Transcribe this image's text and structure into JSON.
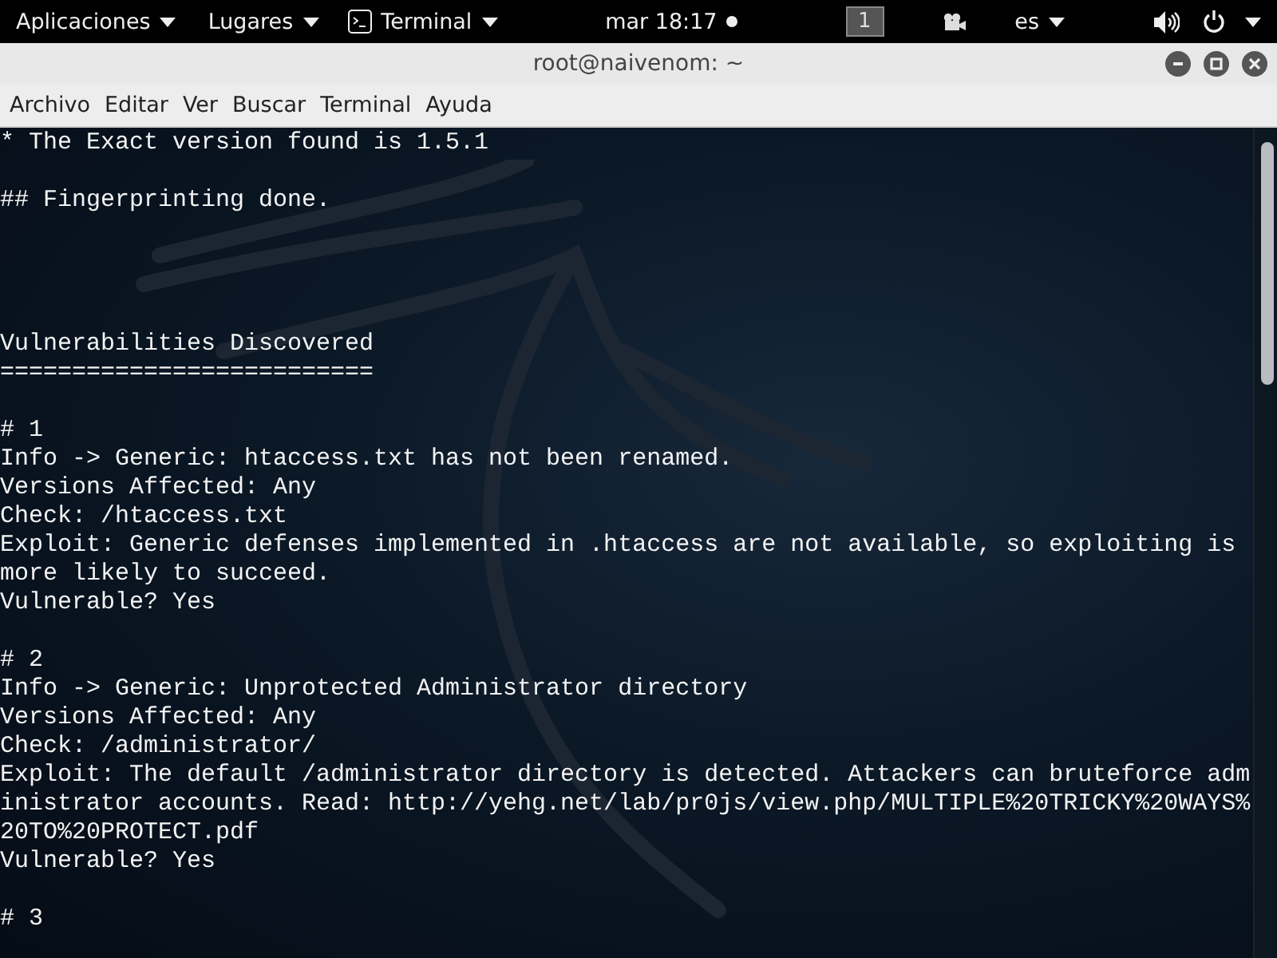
{
  "top_bar": {
    "menus": [
      {
        "kind": "plain",
        "label": "Aplicaciones"
      },
      {
        "kind": "plain",
        "label": "Lugares"
      },
      {
        "kind": "app",
        "label": "Terminal"
      }
    ],
    "clock": "mar 18:17",
    "workspace": "1",
    "language": "es"
  },
  "window": {
    "title": "root@naivenom: ~"
  },
  "menu_bar": [
    "Archivo",
    "Editar",
    "Ver",
    "Buscar",
    "Terminal",
    "Ayuda"
  ],
  "terminal": {
    "lines": [
      {
        "kind": "text",
        "text": "* The Exact version found is 1.5.1"
      },
      {
        "kind": "blank"
      },
      {
        "kind": "text",
        "text": "## Fingerprinting done."
      },
      {
        "kind": "blank"
      },
      {
        "kind": "blank"
      },
      {
        "kind": "blank"
      },
      {
        "kind": "blank"
      },
      {
        "kind": "text",
        "text": "Vulnerabilities Discovered"
      },
      {
        "kind": "text",
        "text": "=========================="
      },
      {
        "kind": "blank"
      },
      {
        "kind": "text",
        "text": "# 1"
      },
      {
        "kind": "text",
        "text": "Info -> Generic: htaccess.txt has not been renamed."
      },
      {
        "kind": "text",
        "text": "Versions Affected: Any"
      },
      {
        "kind": "text",
        "text": "Check: /htaccess.txt"
      },
      {
        "kind": "text",
        "text": "Exploit: Generic defenses implemented in .htaccess are not available, so exploiting is more likely to succeed."
      },
      {
        "kind": "text",
        "text": "Vulnerable? Yes"
      },
      {
        "kind": "blank"
      },
      {
        "kind": "text",
        "text": "# 2"
      },
      {
        "kind": "text",
        "text": "Info -> Generic: Unprotected Administrator directory"
      },
      {
        "kind": "text",
        "text": "Versions Affected: Any"
      },
      {
        "kind": "text",
        "text": "Check: /administrator/"
      },
      {
        "kind": "text",
        "text": "Exploit: The default /administrator directory is detected. Attackers can bruteforce administrator accounts. Read: http://yehg.net/lab/pr0js/view.php/MULTIPLE%20TRICKY%20WAYS%20TO%20PROTECT.pdf"
      },
      {
        "kind": "text",
        "text": "Vulnerable? Yes"
      },
      {
        "kind": "blank"
      },
      {
        "kind": "text",
        "text": "# 3"
      }
    ]
  }
}
